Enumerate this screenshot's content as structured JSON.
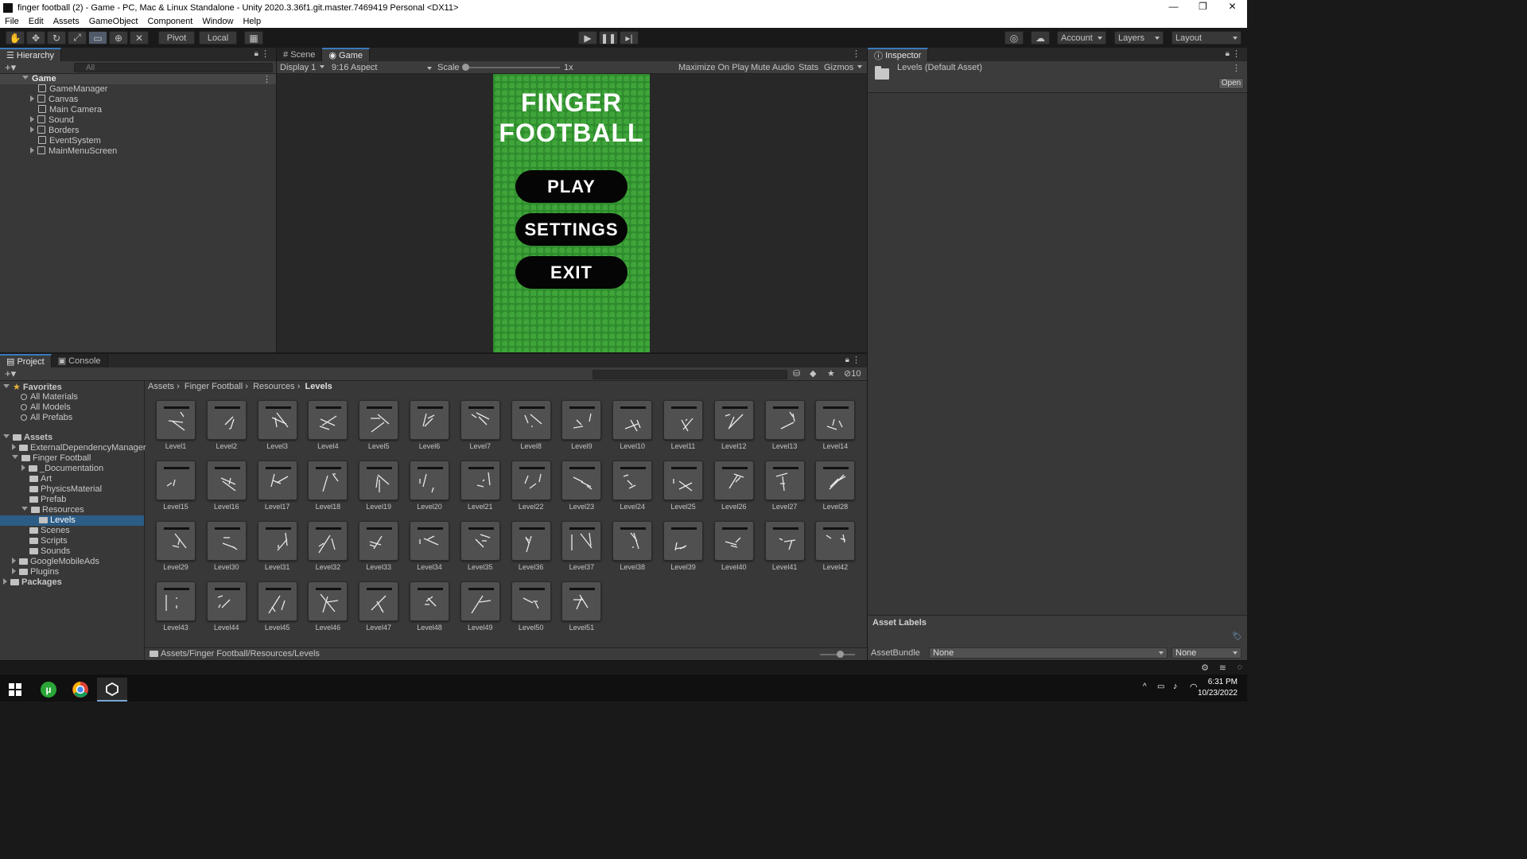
{
  "window": {
    "title": "finger football (2) - Game - PC, Mac & Linux Standalone - Unity 2020.3.36f1.git.master.7469419 Personal <DX11>",
    "controls": [
      "—",
      "❐",
      "✕"
    ]
  },
  "menu": [
    "File",
    "Edit",
    "Assets",
    "GameObject",
    "Component",
    "Window",
    "Help"
  ],
  "toolbar": {
    "pivot": "Pivot",
    "local": "Local",
    "account": "Account",
    "layers": "Layers",
    "layout": "Layout"
  },
  "hierarchy": {
    "tab": "Hierarchy",
    "search_placeholder": "All",
    "scene": "Game",
    "items": [
      "GameManager",
      "Canvas",
      "Main Camera",
      "Sound",
      "Borders",
      "EventSystem",
      "MainMenuScreen"
    ]
  },
  "game_panel": {
    "tabs": [
      "Scene",
      "Game"
    ],
    "display": "Display 1",
    "aspect": "9:16 Aspect",
    "scale_label": "Scale",
    "scale_value": "1x",
    "maximize": "Maximize On Play",
    "mute": "Mute Audio",
    "stats": "Stats",
    "gizmos": "Gizmos",
    "game_title_line1": "FINGER",
    "game_title_line2": "FOOTBALL",
    "buttons": [
      "PLAY",
      "SETTINGS",
      "EXIT"
    ]
  },
  "inspector": {
    "tab": "Inspector",
    "asset_name": "Levels (Default Asset)",
    "open": "Open",
    "asset_labels": "Asset Labels",
    "asset_bundle_label": "AssetBundle",
    "bundle_value": "None",
    "variant_value": "None"
  },
  "project": {
    "tabs": [
      "Project",
      "Console"
    ],
    "hidden_count": "10",
    "favorites": {
      "label": "Favorites",
      "items": [
        "All Materials",
        "All Models",
        "All Prefabs"
      ]
    },
    "tree": {
      "assets": "Assets",
      "external": "ExternalDependencyManager",
      "finger_football": "Finger Football",
      "documentation": "_Documentation",
      "art": "Art",
      "physics": "PhysicsMaterial",
      "prefab": "Prefab",
      "resources": "Resources",
      "levels": "Levels",
      "scenes": "Scenes",
      "scripts": "Scripts",
      "sounds": "Sounds",
      "google": "GoogleMobileAds",
      "plugins": "Plugins",
      "packages": "Packages"
    },
    "breadcrumb": [
      "Assets",
      "Finger Football",
      "Resources",
      "Levels"
    ],
    "levels": [
      "Level1",
      "Level2",
      "Level3",
      "Level4",
      "Level5",
      "Level6",
      "Level7",
      "Level8",
      "Level9",
      "Level10",
      "Level11",
      "Level12",
      "Level13",
      "Level14",
      "Level15",
      "Level16",
      "Level17",
      "Level18",
      "Level19",
      "Level20",
      "Level21",
      "Level22",
      "Level23",
      "Level24",
      "Level25",
      "Level26",
      "Level27",
      "Level28",
      "Level29",
      "Level30",
      "Level31",
      "Level32",
      "Level33",
      "Level34",
      "Level35",
      "Level36",
      "Level37",
      "Level38",
      "Level39",
      "Level40",
      "Level41",
      "Level42",
      "Level43",
      "Level44",
      "Level45",
      "Level46",
      "Level47",
      "Level48",
      "Level49",
      "Level50",
      "Level51"
    ],
    "footer_path": "Assets/Finger Football/Resources/Levels"
  },
  "taskbar": {
    "time": "6:31 PM",
    "date": "10/23/2022"
  }
}
